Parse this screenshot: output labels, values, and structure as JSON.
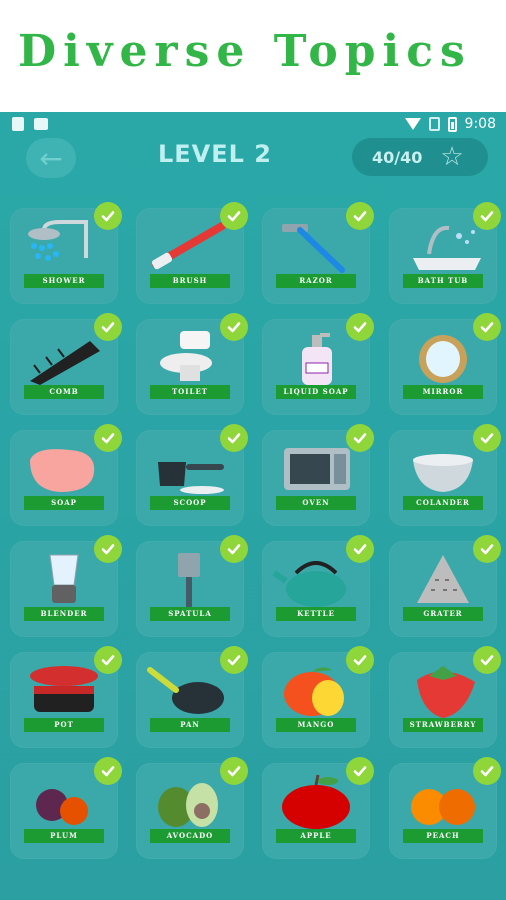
{
  "banner": {
    "title": "Diverse Topics"
  },
  "status_bar": {
    "time": "9:08"
  },
  "header": {
    "title": "LEVEL 2",
    "score": "40/40"
  },
  "items": [
    {
      "label": "SHOWER",
      "icon": "shower-icon"
    },
    {
      "label": "BRUSH",
      "icon": "brush-icon"
    },
    {
      "label": "RAZOR",
      "icon": "razor-icon"
    },
    {
      "label": "BATH TUB",
      "icon": "bathtub-icon"
    },
    {
      "label": "COMB",
      "icon": "comb-icon"
    },
    {
      "label": "TOILET",
      "icon": "toilet-icon"
    },
    {
      "label": "LIQUID SOAP",
      "icon": "liquid-soap-icon"
    },
    {
      "label": "MIRROR",
      "icon": "mirror-icon"
    },
    {
      "label": "SOAP",
      "icon": "soap-icon"
    },
    {
      "label": "SCOOP",
      "icon": "scoop-icon"
    },
    {
      "label": "OVEN",
      "icon": "oven-icon"
    },
    {
      "label": "COLANDER",
      "icon": "colander-icon"
    },
    {
      "label": "BLENDER",
      "icon": "blender-icon"
    },
    {
      "label": "SPATULA",
      "icon": "spatula-icon"
    },
    {
      "label": "KETTLE",
      "icon": "kettle-icon"
    },
    {
      "label": "GRATER",
      "icon": "grater-icon"
    },
    {
      "label": "POT",
      "icon": "pot-icon"
    },
    {
      "label": "PAN",
      "icon": "pan-icon"
    },
    {
      "label": "MANGO",
      "icon": "mango-icon"
    },
    {
      "label": "STRAWBERRY",
      "icon": "strawberry-icon"
    },
    {
      "label": "PLUM",
      "icon": "plum-icon"
    },
    {
      "label": "AVOCADO",
      "icon": "avocado-icon"
    },
    {
      "label": "APPLE",
      "icon": "apple-icon"
    },
    {
      "label": "PEACH",
      "icon": "peach-icon"
    }
  ],
  "colors": {
    "background": "#2aa8a8",
    "card": "#3ba9aa",
    "label": "#1c9b33",
    "check": "#8fd63a",
    "banner_text": "#33b648"
  }
}
